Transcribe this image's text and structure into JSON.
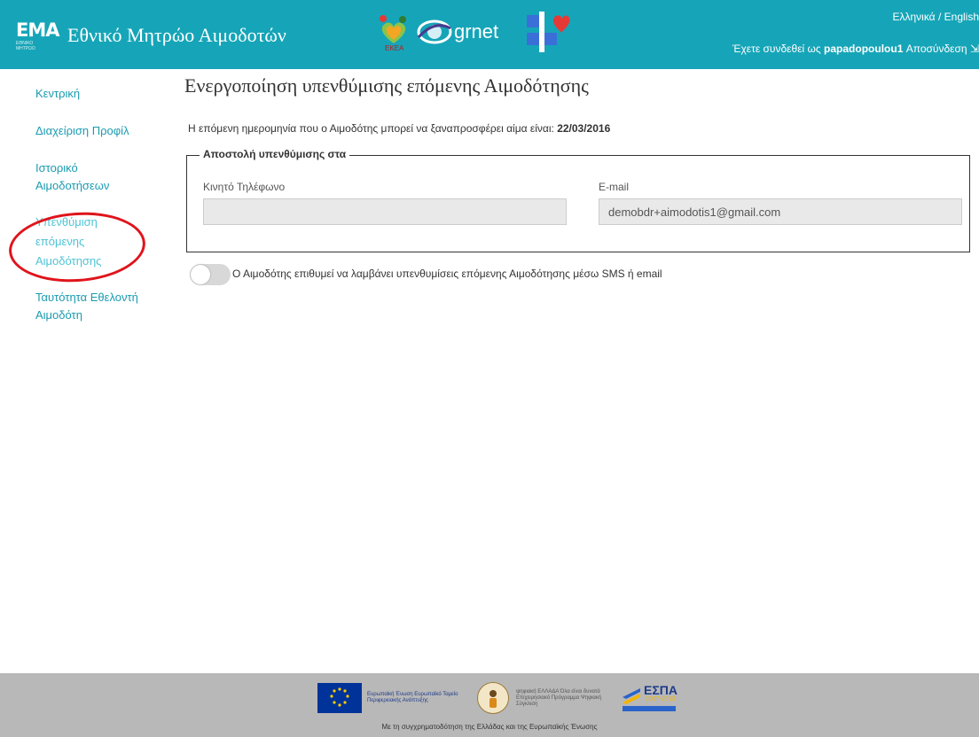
{
  "header": {
    "brand_logo_text": "ΕΜΑ",
    "brand_logo_subtext": "ΕΘΝΙΚΟ ΜΗΤΡΩΟ",
    "brand_title": "Εθνικό Μητρώο Αιμοδοτών",
    "partner_ekea_text": "ΕΚΕΑ",
    "partner_grnet_text": "grnet",
    "lang_el": "Ελληνικά",
    "lang_sep": " / ",
    "lang_en": "English",
    "logged_in_prefix": "Έχετε συνδεθεί ως ",
    "username": "papadopoulou1",
    "logout_label": "Αποσύνδεση"
  },
  "sidebar": {
    "items": [
      {
        "label": "Κεντρική"
      },
      {
        "label": "Διαχείριση Προφίλ"
      },
      {
        "label": "Ιστορικό Αιμοδοτήσεων"
      },
      {
        "label": "Υπενθύμιση επόμενης Αιμοδότησης",
        "active": true
      },
      {
        "label": "Ταυτότητα Εθελοντή Αιμοδότη"
      }
    ]
  },
  "main": {
    "title": "Ενεργοποίηση υπενθύμισης επόμενης Αιμοδότησης",
    "next_date_text": "Η επόμενη ημερομηνία που ο Αιμοδότης μπορεί να ξαναπροσφέρει αίμα είναι: ",
    "next_date_value": "22/03/2016",
    "fieldset_legend": "Αποστολή υπενθύμισης στα",
    "phone_label": "Κινητό Τηλέφωνο",
    "phone_value": "",
    "email_label": "E-mail",
    "email_value": "demobdr+aimodotis1@gmail.com",
    "toggle_on": false,
    "toggle_label": "Ο Αιμοδότης επιθυμεί να λαμβάνει υπενθυμίσεις επόμενης Αιμοδότησης μέσω SMS ή email"
  },
  "footer": {
    "eu_text": "Ευρωπαϊκή Ένωση Ευρωπαϊκό Ταμείο Περιφερειακής Ανάπτυξης",
    "digital_text": "ψηφιακή ΕΛΛΑΔΑ Όλα είναι δυνατά Επιχειρησιακό Πρόγραμμα Ψηφιακή Σύγκλιση",
    "espa_text": "ΕΣΠΑ",
    "espa_years": "2007-2013",
    "caption": "Με τη συγχρηματοδότηση της Ελλάδας και της Ευρωπαϊκής Ένωσης"
  },
  "colors": {
    "header_bg": "#16a5b8",
    "link": "#1a9bb0",
    "active_link": "#4fc3d6",
    "annotation_circle": "#e0141b",
    "footer_bg": "#b8b8b8"
  }
}
